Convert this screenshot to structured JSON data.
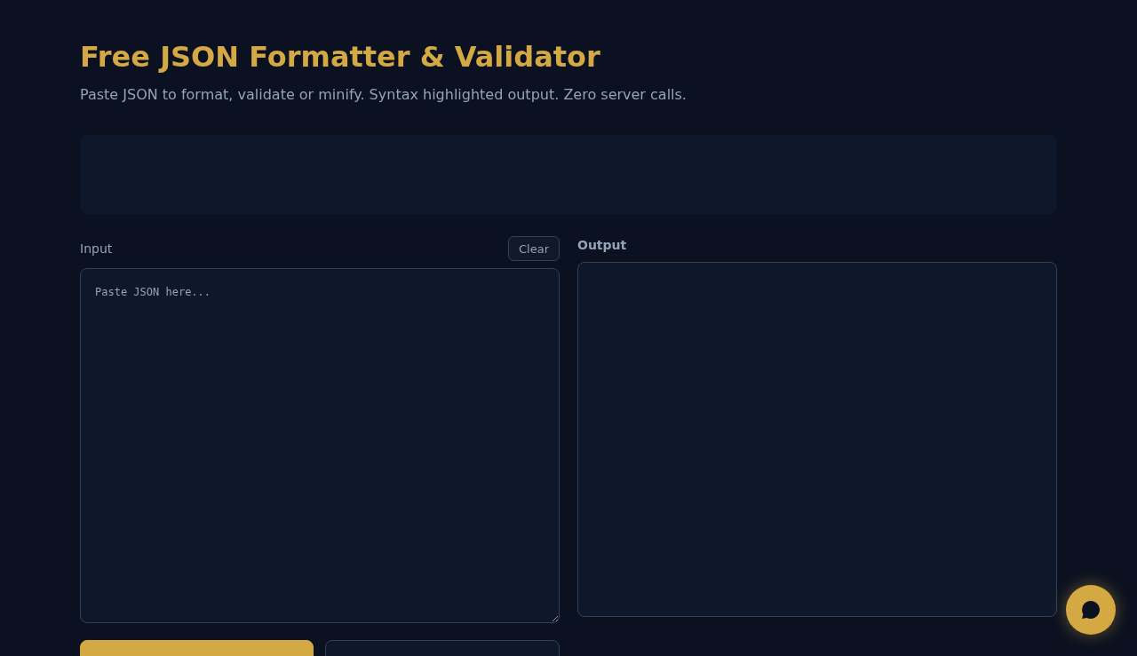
{
  "header": {
    "title": "Free JSON Formatter & Validator",
    "subtitle": "Paste JSON to format, validate or minify. Syntax highlighted output. Zero server calls."
  },
  "input_panel": {
    "label": "Input",
    "clear_button": "Clear",
    "placeholder": "Paste JSON here..."
  },
  "output_panel": {
    "label": "Output"
  },
  "action_buttons": [
    {
      "kind": "primary"
    },
    {
      "kind": "secondary"
    }
  ]
}
